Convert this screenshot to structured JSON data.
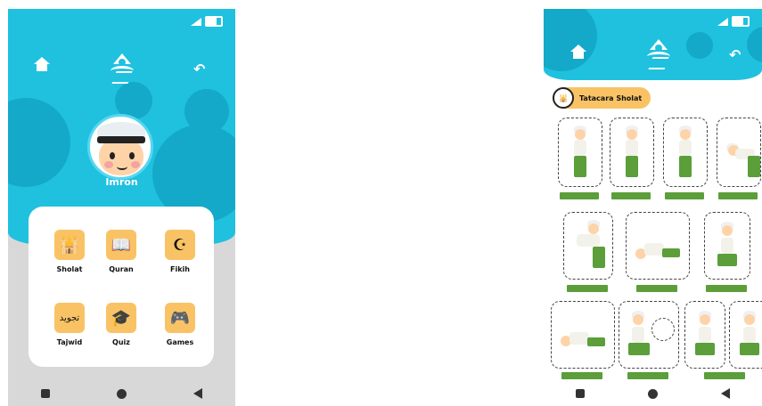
{
  "home": {
    "username": "Imron",
    "menu": [
      {
        "label": "Sholat",
        "icon": "mosque-icon"
      },
      {
        "label": "Quran",
        "icon": "quran-book-icon"
      },
      {
        "label": "Fikih",
        "icon": "crescent-star-icon"
      },
      {
        "label": "Tajwid",
        "icon": "arabic-calligraphy-icon",
        "icon_text": "تجويد"
      },
      {
        "label": "Quiz",
        "icon": "graduation-cap-icon"
      },
      {
        "label": "Games",
        "icon": "gamepad-icon"
      }
    ]
  },
  "sholat": {
    "title": "Tatacara Sholat"
  },
  "colors": {
    "accent": "#1fc1df",
    "bubble": "#14a9c9",
    "tile": "#f9c365",
    "label_green": "#5b9e3a",
    "nav": "#333333"
  }
}
